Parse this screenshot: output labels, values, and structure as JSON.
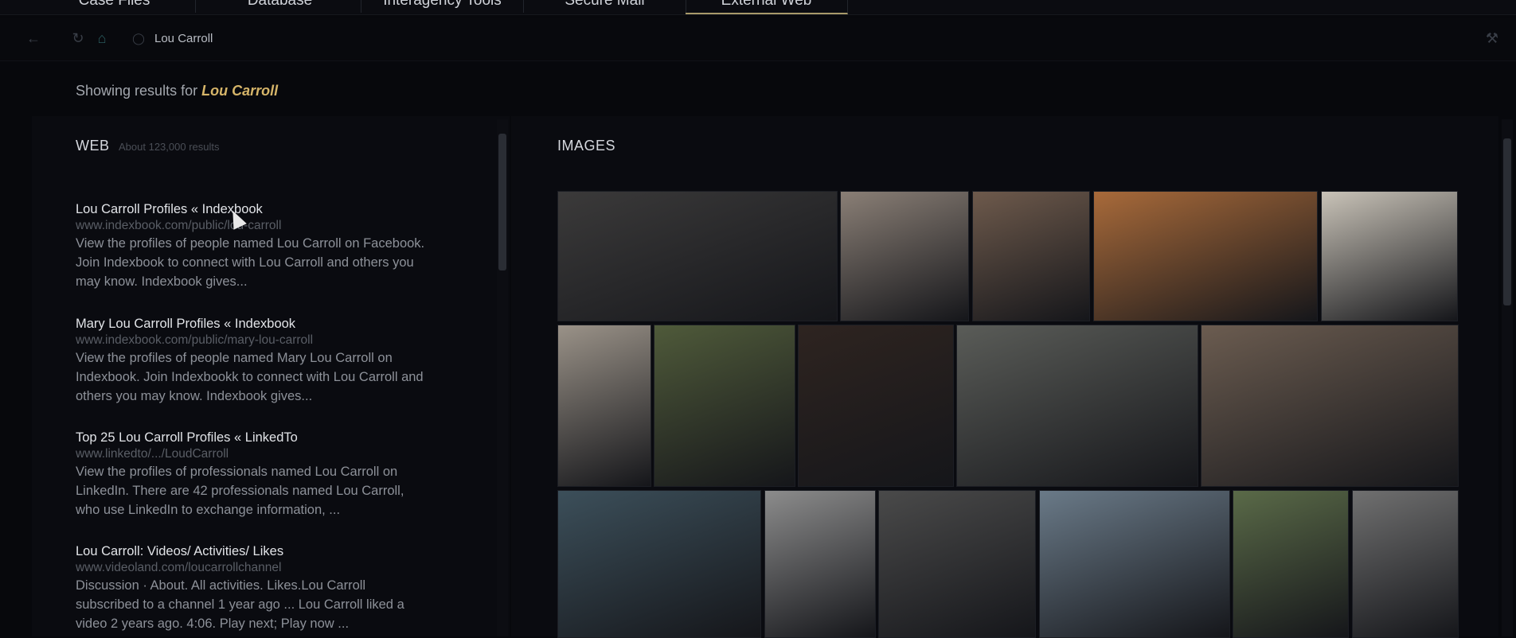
{
  "tabs": [
    {
      "label": "Case Files",
      "active": false
    },
    {
      "label": "Database",
      "active": false
    },
    {
      "label": "Interagency Tools",
      "active": false
    },
    {
      "label": "Secure Mail",
      "active": false
    },
    {
      "label": "External Web",
      "active": true
    }
  ],
  "nav": {
    "back_icon": "arrow-left-icon",
    "refresh_icon": "refresh-icon",
    "home_icon": "home-icon",
    "lock_icon": "lock-icon",
    "address": "Lou Carroll",
    "settings_icon": "wrench-icon"
  },
  "search": {
    "showing_prefix": "Showing results for",
    "query": "Lou Carroll"
  },
  "web": {
    "title": "WEB",
    "count": "About 123,000 results",
    "results": [
      {
        "title": "Lou Carroll Profiles « Indexbook",
        "url": "www.indexbook.com/public/lou-carroll",
        "desc": "View the profiles of people named Lou Carroll on Facebook. Join Indexbook to connect with Lou Carroll and others you may know. Indexbook gives..."
      },
      {
        "title": "Mary Lou Carroll Profiles « Indexbook",
        "url": "www.indexbook.com/public/mary-lou-carroll",
        "desc": "View the profiles of people named Mary Lou Carroll on Indexbook. Join Indexbookk to connect with Lou Carroll and others you may know. Indexbook gives..."
      },
      {
        "title": "Top 25 Lou Carroll Profiles « LinkedTo",
        "url": "www.linkedto/.../LoudCarroll",
        "desc": "View the profiles of professionals named Lou Carroll on LinkedIn. There are 42 professionals named Lou Carroll, who use LinkedIn to exchange information, ..."
      },
      {
        "title": "Lou Carroll: Videos/ Activities/ Likes",
        "url": "www.videoland.com/loucarrollchannel",
        "desc": "Discussion · About. All activities. Likes.Lou Carroll subscribed to a channel 1 year ago ... Lou Carroll liked a video 2 years ago. 4:06. Play next; Play now ..."
      }
    ]
  },
  "images": {
    "title": "IMAGES",
    "thumbs": [
      {
        "name": "image-family-portrait",
        "color": "#3b3a3a"
      },
      {
        "name": "image-older-man-smiling",
        "color": "#8a7f76"
      },
      {
        "name": "image-young-man-tie",
        "color": "#6e5a4c"
      },
      {
        "name": "image-pumpkin",
        "color": "#a86a3a"
      },
      {
        "name": "image-boy-pumpkin",
        "color": "#c9c3b8"
      },
      {
        "name": "image-man-child-shoulders",
        "color": "#9a9288"
      },
      {
        "name": "image-gardener",
        "color": "#4f5a3a"
      },
      {
        "name": "image-young-man-portrait",
        "color": "#2e2420"
      },
      {
        "name": "image-toddler-path",
        "color": "#5a5c58"
      },
      {
        "name": "image-man-kissing-baby",
        "color": "#6b5c50"
      },
      {
        "name": "image-man-woman-outdoors",
        "color": "#3c4f5a"
      },
      {
        "name": "image-couple-boat",
        "color": "#8c8c8c"
      },
      {
        "name": "image-vintage-portrait",
        "color": "#4a4a4a"
      },
      {
        "name": "image-selfie-sunglasses",
        "color": "#6a7a88"
      },
      {
        "name": "image-elderly-woman",
        "color": "#5a6a48"
      },
      {
        "name": "image-shirtless-man",
        "color": "#707070"
      },
      {
        "name": "image-man-laughing",
        "color": "#4a3a32"
      }
    ]
  }
}
